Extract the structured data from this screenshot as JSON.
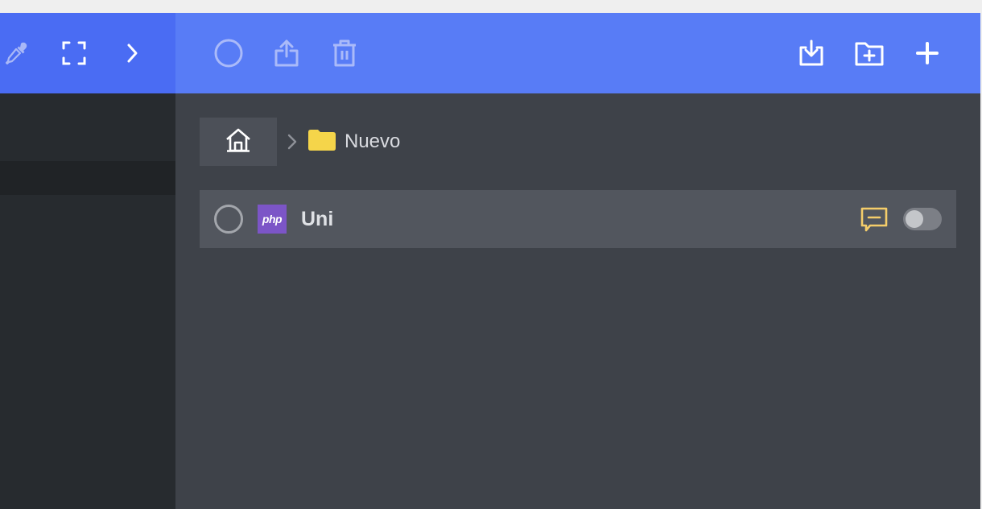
{
  "left_toolbar": {
    "icons": [
      {
        "name": "eyedropper-icon"
      },
      {
        "name": "fullscreen-icon"
      },
      {
        "name": "chevron-right-icon"
      }
    ]
  },
  "right_toolbar": {
    "left_actions": [
      {
        "name": "select-all-icon",
        "enabled": false
      },
      {
        "name": "share-icon",
        "enabled": false
      },
      {
        "name": "trash-icon",
        "enabled": false
      }
    ],
    "right_actions": [
      {
        "name": "import-icon"
      },
      {
        "name": "new-folder-icon"
      },
      {
        "name": "plus-icon"
      }
    ]
  },
  "breadcrumb": {
    "home_icon": "home-icon",
    "separator_icon": "chevron-right-icon",
    "folder_icon": "folder-icon",
    "current_folder": "Nuevo"
  },
  "files": [
    {
      "name": "Uni",
      "type_badge": "php",
      "selected": false,
      "has_comment": true,
      "toggle_on": false
    }
  ],
  "colors": {
    "left_toolbar": "#4a6cf3",
    "right_toolbar": "#587cf6",
    "folder": "#f5d54a",
    "comment": "#f5cd6a",
    "php_badge": "#7c55c7"
  }
}
